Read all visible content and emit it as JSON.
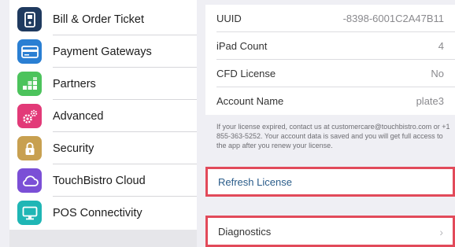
{
  "sidebar": {
    "items": [
      {
        "label": "Bill & Order Ticket",
        "icon": "receipt-icon",
        "color": "#1f3a5f"
      },
      {
        "label": "Payment Gateways",
        "icon": "credit-card-icon",
        "color": "#2a7fd3"
      },
      {
        "label": "Partners",
        "icon": "grid-icon",
        "color": "#4cc35c"
      },
      {
        "label": "Advanced",
        "icon": "gears-icon",
        "color": "#e23a78"
      },
      {
        "label": "Security",
        "icon": "lock-icon",
        "color": "#c8a050"
      },
      {
        "label": "TouchBistro Cloud",
        "icon": "cloud-icon",
        "color": "#7b4fd6"
      },
      {
        "label": "POS Connectivity",
        "icon": "monitor-icon",
        "color": "#1fb6b5"
      }
    ]
  },
  "license": {
    "rows": [
      {
        "label": "UUID",
        "value": "-8398-6001C2A47B11"
      },
      {
        "label": "iPad Count",
        "value": "4"
      },
      {
        "label": "CFD License",
        "value": "No"
      },
      {
        "label": "Account Name",
        "value": "plate3"
      }
    ],
    "footnote": "If your license expired, contact us at customercare@touchbistro.com or +1 855-363-5252. Your account data is saved and you will get full access to the app after you renew your license."
  },
  "actions": {
    "refresh_label": "Refresh License",
    "diagnostics_label": "Diagnostics",
    "chevron": "›"
  },
  "colors": {
    "highlight": "#e24a5a",
    "link": "#2a5c8a"
  }
}
